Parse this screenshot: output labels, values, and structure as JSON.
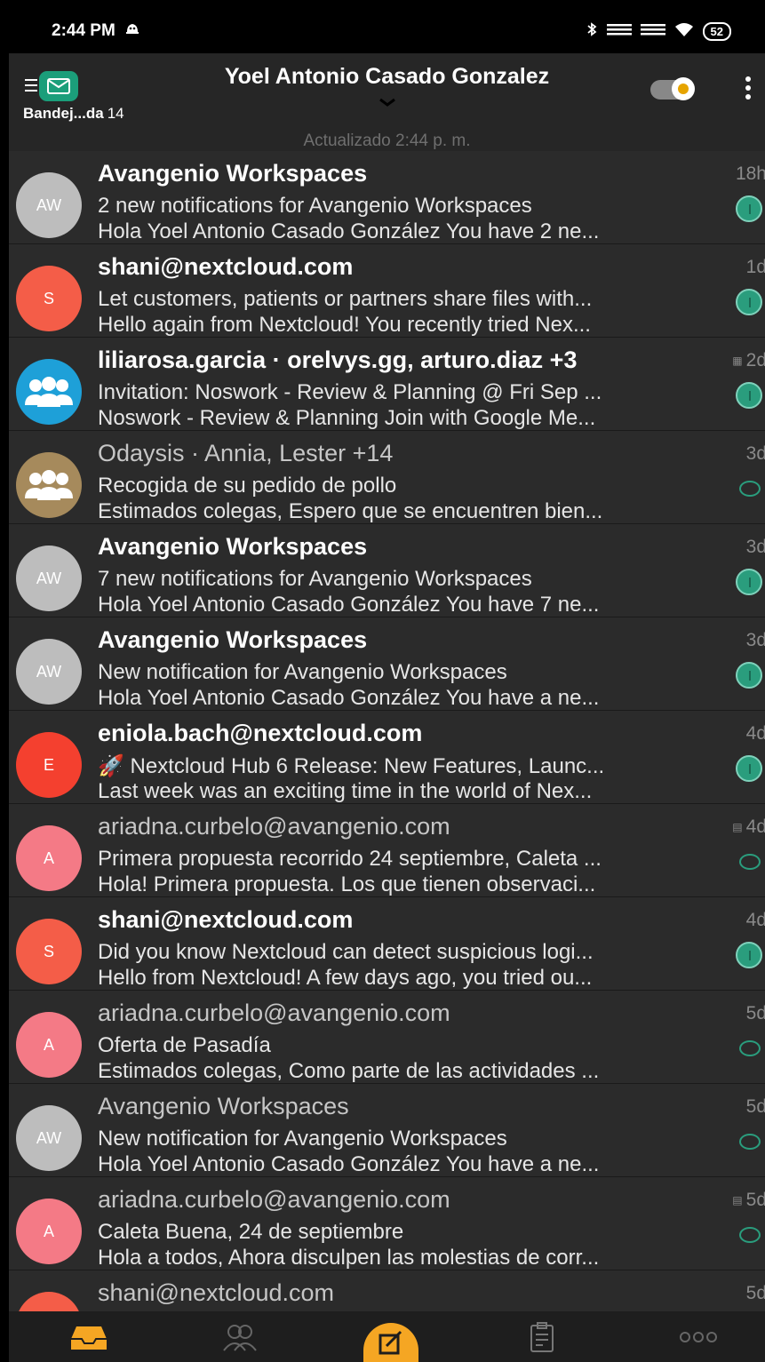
{
  "status_bar": {
    "time": "2:44 PM",
    "battery": "52"
  },
  "header": {
    "folder_name": "Bandej...da",
    "folder_count": "14",
    "account_name": "Yoel Antonio Casado Gonzalez",
    "updated_text": "Actualizado 2:44 p. m."
  },
  "messages": [
    {
      "initials": "AW",
      "avatar_color": "#bdbdbd",
      "sender": "Avangenio Workspaces",
      "subject": "2 new notifications for Avangenio Workspaces",
      "preview": "Hola Yoel Antonio Casado González You have 2 ne...",
      "date": "18h",
      "unread": true
    },
    {
      "initials": "S",
      "avatar_color": "#f45d48",
      "sender": "shani@nextcloud.com",
      "subject": "Let customers, patients or partners share files with...",
      "preview": "Hello again from Nextcloud! You recently tried Nex...",
      "date": "1d",
      "unread": true
    },
    {
      "initials": "",
      "avatar_color": "#1ea0d8",
      "avatar_icon": "group-icon",
      "sender": "liliarosa.garcia · orelvys.gg, arturo.diaz +3",
      "subject": "Invitation: Noswork - Review & Planning @ Fri Sep ...",
      "preview": "Noswork - Review & Planning Join with Google Me...",
      "date": "2d",
      "attachment": "calendar-icon",
      "unread": true
    },
    {
      "initials": "",
      "avatar_color": "#a68a5c",
      "avatar_icon": "group-icon",
      "sender": "Odaysis · Annia, Lester +14",
      "subject": "Recogida de su pedido de pollo",
      "preview": "Estimados colegas, Espero que se encuentren bien...",
      "date": "3d",
      "unread": false
    },
    {
      "initials": "AW",
      "avatar_color": "#bdbdbd",
      "sender": "Avangenio Workspaces",
      "subject": "7 new notifications for Avangenio Workspaces",
      "preview": "Hola Yoel Antonio Casado González You have 7 ne...",
      "date": "3d",
      "unread": true
    },
    {
      "initials": "AW",
      "avatar_color": "#bdbdbd",
      "sender": "Avangenio Workspaces",
      "subject": "New notification for Avangenio Workspaces",
      "preview": "Hola Yoel Antonio Casado González You have a ne...",
      "date": "3d",
      "unread": true
    },
    {
      "initials": "E",
      "avatar_color": "#f4402f",
      "sender": "eniola.bach@nextcloud.com",
      "subject": "🚀 Nextcloud Hub 6 Release: New Features, Launc...",
      "preview": "Last week was an exciting time in the world of Nex...",
      "date": "4d",
      "unread": true
    },
    {
      "initials": "A",
      "avatar_color": "#f47a86",
      "sender": "ariadna.curbelo@avangenio.com",
      "subject": "Primera propuesta recorrido 24 septiembre, Caleta ...",
      "preview": "Hola! Primera propuesta. Los que tienen observaci...",
      "date": "4d",
      "attachment": "attachment-icon",
      "unread": false
    },
    {
      "initials": "S",
      "avatar_color": "#f45d48",
      "sender": "shani@nextcloud.com",
      "subject": "Did you know Nextcloud can detect suspicious logi...",
      "preview": "Hello from Nextcloud! A few days ago, you tried ou...",
      "date": "4d",
      "unread": true
    },
    {
      "initials": "A",
      "avatar_color": "#f47a86",
      "sender": "ariadna.curbelo@avangenio.com",
      "subject": "Oferta de Pasadía",
      "preview": "Estimados colegas, Como parte de las actividades ...",
      "date": "5d",
      "unread": false
    },
    {
      "initials": "AW",
      "avatar_color": "#bdbdbd",
      "sender": "Avangenio Workspaces",
      "subject": "New notification for Avangenio Workspaces",
      "preview": "Hola Yoel Antonio Casado González You have a ne...",
      "date": "5d",
      "unread": false
    },
    {
      "initials": "A",
      "avatar_color": "#f47a86",
      "sender": "ariadna.curbelo@avangenio.com",
      "subject": "Caleta Buena, 24 de septiembre",
      "preview": "Hola a todos, Ahora disculpen las molestias de corr...",
      "date": "5d",
      "attachment": "attachment-icon",
      "unread": false
    },
    {
      "initials": "S",
      "avatar_color": "#f45d48",
      "sender": "shani@nextcloud.com",
      "subject": "",
      "preview": "",
      "date": "5d",
      "unread": false
    }
  ],
  "colors": {
    "accent": "#f5a623",
    "unread_dot": "#2a9d7d",
    "background": "#2b2b2b"
  }
}
